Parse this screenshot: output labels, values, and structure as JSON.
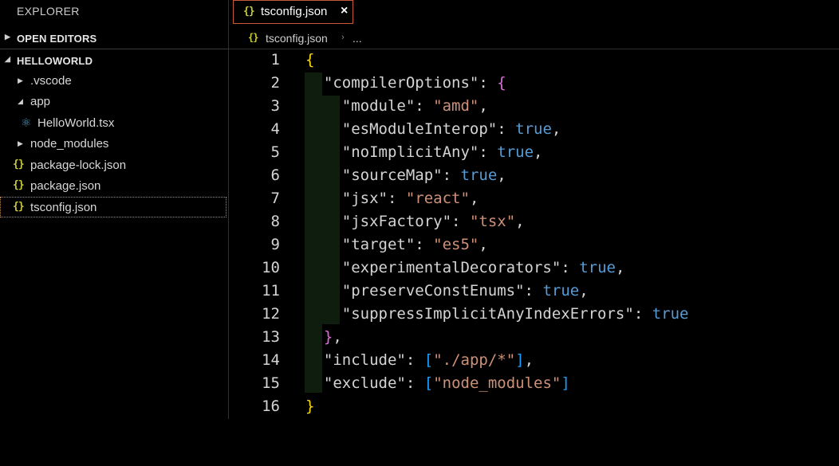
{
  "sidebar": {
    "title": "EXPLORER",
    "open_editors": "OPEN EDITORS",
    "project": "HELLOWORLD",
    "items": [
      {
        "label": ".vscode"
      },
      {
        "label": "app"
      },
      {
        "label": "HelloWorld.tsx"
      },
      {
        "label": "node_modules"
      },
      {
        "label": "package-lock.json"
      },
      {
        "label": "package.json"
      },
      {
        "label": "tsconfig.json"
      }
    ]
  },
  "tab": {
    "label": "tsconfig.json",
    "close": "×",
    "icon": "{}"
  },
  "breadcrumb": {
    "file": "tsconfig.json",
    "more": "..."
  },
  "editor": {
    "lines": [
      {
        "n": "1"
      },
      {
        "n": "2"
      },
      {
        "n": "3"
      },
      {
        "n": "4"
      },
      {
        "n": "5"
      },
      {
        "n": "6"
      },
      {
        "n": "7"
      },
      {
        "n": "8"
      },
      {
        "n": "9"
      },
      {
        "n": "10"
      },
      {
        "n": "11"
      },
      {
        "n": "12"
      },
      {
        "n": "13"
      },
      {
        "n": "14"
      },
      {
        "n": "15"
      },
      {
        "n": "16"
      }
    ],
    "tokens": {
      "l1": {
        "a": "{"
      },
      "l2": {
        "key": "\"compilerOptions\"",
        "colon": ": ",
        "open": "{"
      },
      "l3": {
        "key": "\"module\"",
        "colon": ": ",
        "val": "\"amd\"",
        "comma": ","
      },
      "l4": {
        "key": "\"esModuleInterop\"",
        "colon": ": ",
        "val": "true",
        "comma": ","
      },
      "l5": {
        "key": "\"noImplicitAny\"",
        "colon": ": ",
        "val": "true",
        "comma": ","
      },
      "l6": {
        "key": "\"sourceMap\"",
        "colon": ": ",
        "val": "true",
        "comma": ","
      },
      "l7": {
        "key": "\"jsx\"",
        "colon": ": ",
        "val": "\"react\"",
        "comma": ","
      },
      "l8": {
        "key": "\"jsxFactory\"",
        "colon": ": ",
        "val": "\"tsx\"",
        "comma": ","
      },
      "l9": {
        "key": "\"target\"",
        "colon": ": ",
        "val": "\"es5\"",
        "comma": ","
      },
      "l10": {
        "key": "\"experimentalDecorators\"",
        "colon": ": ",
        "val": "true",
        "comma": ","
      },
      "l11": {
        "key": "\"preserveConstEnums\"",
        "colon": ": ",
        "val": "true",
        "comma": ","
      },
      "l12": {
        "key": "\"suppressImplicitAnyIndexErrors\"",
        "colon": ": ",
        "val": "true"
      },
      "l13": {
        "close": "}",
        "comma": ","
      },
      "l14": {
        "key": "\"include\"",
        "colon": ": ",
        "open": "[",
        "val": "\"./app/*\"",
        "close": "]",
        "comma": ","
      },
      "l15": {
        "key": "\"exclude\"",
        "colon": ": ",
        "open": "[",
        "val": "\"node_modules\"",
        "close": "]"
      },
      "l16": {
        "a": "}"
      }
    }
  },
  "colors": {
    "string": "#ce9178",
    "boolean": "#569cd6",
    "bracket1": "#ffd700",
    "bracket2": "#da70d6",
    "bracket3": "#179fff",
    "json_icon": "#cbcb41",
    "tab_border": "#c45a3a"
  }
}
